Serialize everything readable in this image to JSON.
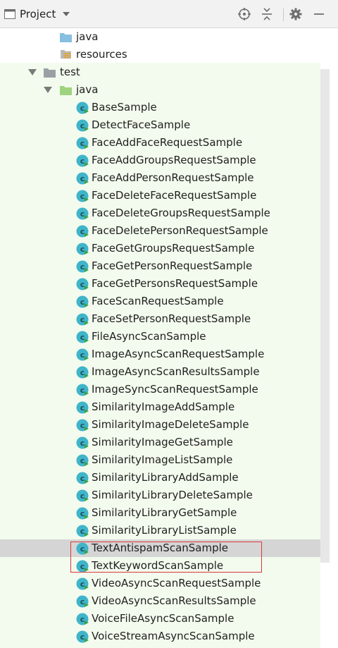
{
  "header": {
    "title": "Project",
    "icons": [
      "project-view-icon",
      "dropdown-caret-icon",
      "locate-icon",
      "collapse-all-icon",
      "settings-gear-icon",
      "hide-minus-icon"
    ]
  },
  "tree": {
    "resources_siblings": [
      {
        "label": "java",
        "icon": "folder-blue-icon"
      },
      {
        "label": "resources",
        "icon": "resources-folder-icon"
      }
    ],
    "test_node": {
      "label": "test",
      "icon": "folder-gray-icon"
    },
    "test_java_node": {
      "label": "java",
      "icon": "folder-green-icon"
    },
    "classes": [
      "BaseSample",
      "DetectFaceSample",
      "FaceAddFaceRequestSample",
      "FaceAddGroupsRequestSample",
      "FaceAddPersonRequestSample",
      "FaceDeleteFaceRequestSample",
      "FaceDeleteGroupsRequestSample",
      "FaceDeletePersonRequestSample",
      "FaceGetGroupsRequestSample",
      "FaceGetPersonRequestSample",
      "FaceGetPersonsRequestSample",
      "FaceScanRequestSample",
      "FaceSetPersonRequestSample",
      "FileAsyncScanSample",
      "ImageAsyncScanRequestSample",
      "ImageAsyncScanResultsSample",
      "ImageSyncScanRequestSample",
      "SimilarityImageAddSample",
      "SimilarityImageDeleteSample",
      "SimilarityImageGetSample",
      "SimilarityImageListSample",
      "SimilarityLibraryAddSample",
      "SimilarityLibraryDeleteSample",
      "SimilarityLibraryGetSample",
      "SimilarityLibraryListSample",
      "TextAntispamScanSample",
      "TextKeywordScanSample",
      "VideoAsyncScanRequestSample",
      "VideoAsyncScanResultsSample",
      "VoiceFileAsyncScanSample",
      "VoiceStreamAsyncScanSample"
    ],
    "selected_class": "TextAntispamScanSample"
  },
  "colors": {
    "header_bg": "#f2f2f2",
    "test_bg": "#f3fbee",
    "selected_row": "#d5d5d5",
    "class_icon": "#3fb5ca",
    "folder_blue": "#87bfe0",
    "folder_green": "#9fd37f",
    "highlight_box": "#d9383a"
  }
}
